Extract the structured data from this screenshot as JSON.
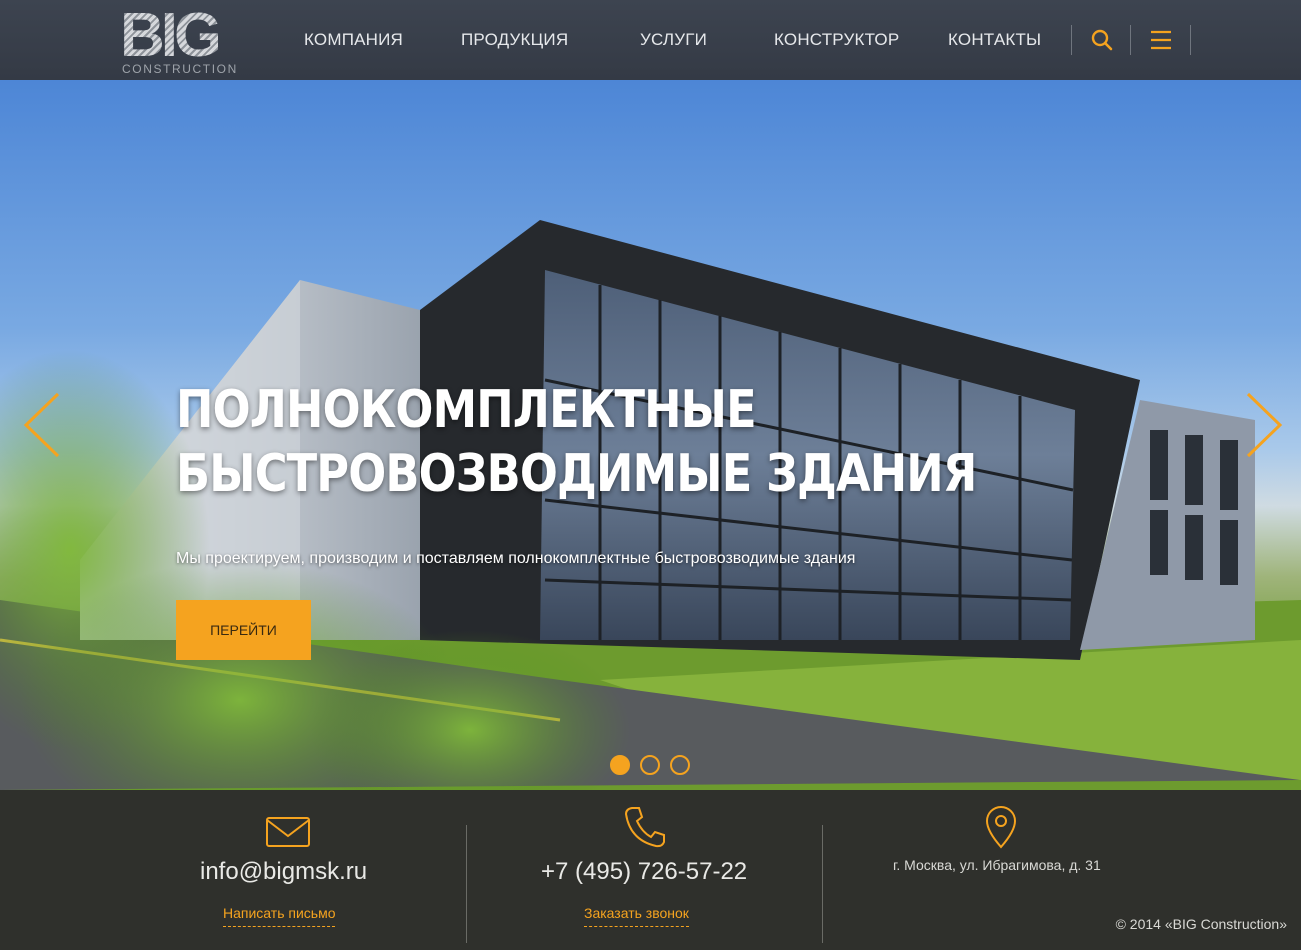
{
  "logo": {
    "main": "BIG",
    "sub": "CONSTRUCTION"
  },
  "nav": {
    "items": [
      {
        "label": "КОМПАНИЯ"
      },
      {
        "label": "ПРОДУКЦИЯ"
      },
      {
        "label": "УСЛУГИ"
      },
      {
        "label": "КОНСТРУКТОР"
      },
      {
        "label": "КОНТАКТЫ"
      }
    ],
    "icons": [
      "search-icon",
      "menu-icon"
    ]
  },
  "hero": {
    "title_line1": "ПОЛНОКОМПЛЕКТНЫЕ",
    "title_line2": "БЫСТРОВОЗВОДИМЫЕ ЗДАНИЯ",
    "subtitle": "Мы проектируем, производим и поставляем полнокомплектные быстровозводимые здания",
    "button_label": "ПЕРЕЙТИ",
    "slides_total": 3,
    "active_slide": 1
  },
  "footer": {
    "email": "info@bigmsk.ru",
    "email_link": "Написать письмо",
    "phone": "+7 (495) 726-57-22",
    "phone_link": "Заказать звонок",
    "address": "г. Москва, ул. Ибрагимова, д. 31",
    "copyright": "© 2014 «BIG Construction»"
  },
  "colors": {
    "accent": "#f5a31f",
    "header_bg": "#3a404b",
    "footer_bg": "#2f302c"
  }
}
